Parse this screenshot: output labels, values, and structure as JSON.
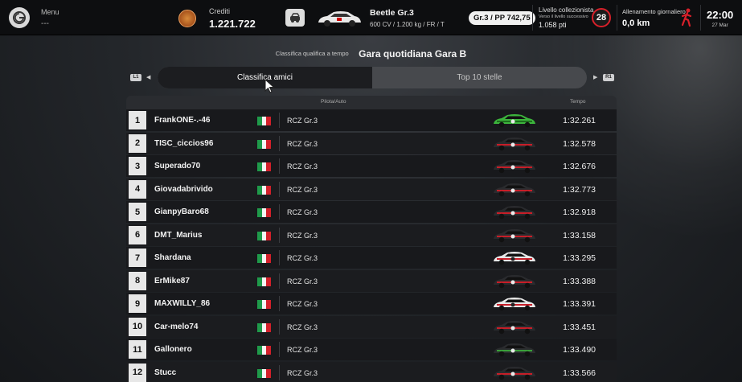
{
  "topbar": {
    "menu_label": "Menu",
    "menu_value": "---",
    "credits_label": "Crediti",
    "credits_value": "1.221.722",
    "car_name": "Beetle Gr.3",
    "car_spec": "600 CV / 1.200 kg / FR / T",
    "pp_badge": "Gr.3 / PP 742,75",
    "collector_label": "Livello collezionista",
    "collector_sub": "Verso il livello successivo",
    "collector_points": "1.058 pti",
    "collector_level": "28",
    "training_label": "Allenamento giornaliero",
    "training_value": "0,0 km",
    "clock_time": "22:00",
    "clock_date": "27 Mar"
  },
  "header": {
    "subtitle": "Classifica qualifica a tempo",
    "title": "Gara quotidiana Gara B"
  },
  "tabs": {
    "l1": "L1",
    "r1": "R1",
    "items": [
      {
        "label": "Classifica amici",
        "active": true
      },
      {
        "label": "Top 10 stelle",
        "active": false
      }
    ]
  },
  "table": {
    "col_driver": "Pilota/Auto",
    "col_time": "Tempo",
    "rows": [
      {
        "rank": "1",
        "name": "FrankONE-.-46",
        "car": "RCZ Gr.3",
        "time": "1:32.261",
        "livery": "green"
      },
      {
        "rank": "2",
        "name": "TISC_ciccios96",
        "car": "RCZ Gr.3",
        "time": "1:32.578",
        "livery": "dark"
      },
      {
        "rank": "3",
        "name": "Superado70",
        "car": "RCZ Gr.3",
        "time": "1:32.676",
        "livery": "dark"
      },
      {
        "rank": "4",
        "name": "Giovadabrivido",
        "car": "RCZ Gr.3",
        "time": "1:32.773",
        "livery": "dark"
      },
      {
        "rank": "5",
        "name": "GianpyBaro68",
        "car": "RCZ Gr.3",
        "time": "1:32.918",
        "livery": "dark"
      },
      {
        "rank": "6",
        "name": "DMT_Marius",
        "car": "RCZ Gr.3",
        "time": "1:33.158",
        "livery": "dark"
      },
      {
        "rank": "7",
        "name": "Shardana",
        "car": "RCZ Gr.3",
        "time": "1:33.295",
        "livery": "white"
      },
      {
        "rank": "8",
        "name": "ErMike87",
        "car": "RCZ Gr.3",
        "time": "1:33.388",
        "livery": "dark"
      },
      {
        "rank": "9",
        "name": "MAXWILLY_86",
        "car": "RCZ Gr.3",
        "time": "1:33.391",
        "livery": "white"
      },
      {
        "rank": "10",
        "name": "Car-melo74",
        "car": "RCZ Gr.3",
        "time": "1:33.451",
        "livery": "dark"
      },
      {
        "rank": "11",
        "name": "Gallonero",
        "car": "RCZ Gr.3",
        "time": "1:33.490",
        "livery": "darkgreen"
      },
      {
        "rank": "12",
        "name": "Stucc",
        "car": "RCZ Gr.3",
        "time": "1:33.566",
        "livery": "dark"
      }
    ]
  },
  "colors": {
    "accent_red": "#d8202a",
    "flag_green": "#1f9a4a",
    "flag_white": "#f4f4f4",
    "flag_red": "#d3202a"
  },
  "icons": {
    "logo": "gran-turismo-logo-icon",
    "coin": "credits-coin-icon",
    "garage": "garage-icon",
    "runner": "runner-icon",
    "cursor": "mouse-cursor-icon"
  }
}
